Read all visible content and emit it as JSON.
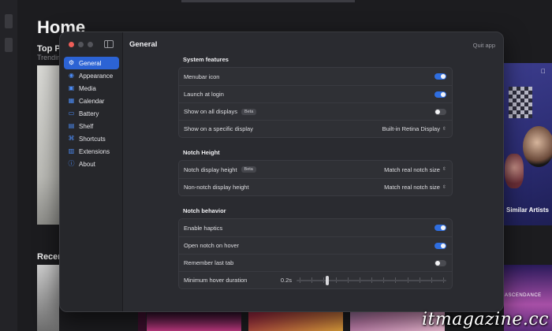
{
  "background": {
    "home_title": "Home",
    "top_section_title": "Top Pi",
    "top_section_sub": "Trendin",
    "recent_title": "Recen",
    "similar_artists": "Similar Artists",
    "apple_music_tag": "",
    "recent_card_text": "ASCENDANCE"
  },
  "window": {
    "title": "General",
    "quit_label": "Quit app"
  },
  "sidebar": {
    "items": [
      {
        "label": "General",
        "icon": "gear-icon",
        "glyph": "⚙",
        "active": true
      },
      {
        "label": "Appearance",
        "icon": "eye-icon",
        "glyph": "◉",
        "active": false
      },
      {
        "label": "Media",
        "icon": "media-icon",
        "glyph": "▣",
        "active": false
      },
      {
        "label": "Calendar",
        "icon": "calendar-icon",
        "glyph": "▦",
        "active": false
      },
      {
        "label": "Battery",
        "icon": "battery-icon",
        "glyph": "▭",
        "active": false
      },
      {
        "label": "Shelf",
        "icon": "shelf-icon",
        "glyph": "▤",
        "active": false
      },
      {
        "label": "Shortcuts",
        "icon": "shortcuts-icon",
        "glyph": "⌘",
        "active": false
      },
      {
        "label": "Extensions",
        "icon": "extensions-icon",
        "glyph": "▥",
        "active": false
      },
      {
        "label": "About",
        "icon": "info-icon",
        "glyph": "ⓘ",
        "active": false
      }
    ]
  },
  "system_features": {
    "title": "System features",
    "menubar_icon": {
      "label": "Menubar icon",
      "on": true
    },
    "launch_at_login": {
      "label": "Launch at login",
      "on": true
    },
    "show_all_displays": {
      "label": "Show on all displays",
      "badge": "Beta",
      "on": false
    },
    "specific_display": {
      "label": "Show on a specific display",
      "value": "Built-in Retina Display"
    }
  },
  "notch_height": {
    "title": "Notch Height",
    "notch_display": {
      "label": "Notch display height",
      "badge": "Beta",
      "value": "Match real notch size"
    },
    "non_notch_display": {
      "label": "Non-notch display height",
      "value": "Match real notch size"
    }
  },
  "notch_behavior": {
    "title": "Notch behavior",
    "haptics": {
      "label": "Enable haptics",
      "on": true
    },
    "open_on_hover": {
      "label": "Open notch on hover",
      "on": true
    },
    "remember_tab": {
      "label": "Remember last tab",
      "on": false
    },
    "hover_duration": {
      "label": "Minimum hover duration",
      "value": "0.2s",
      "fraction": 0.2
    }
  },
  "watermark": "itmagazine.cc",
  "colors": {
    "accent": "#2c63d4",
    "toggle_on": "#2f6ee0",
    "window_bg": "#2a2b30"
  }
}
